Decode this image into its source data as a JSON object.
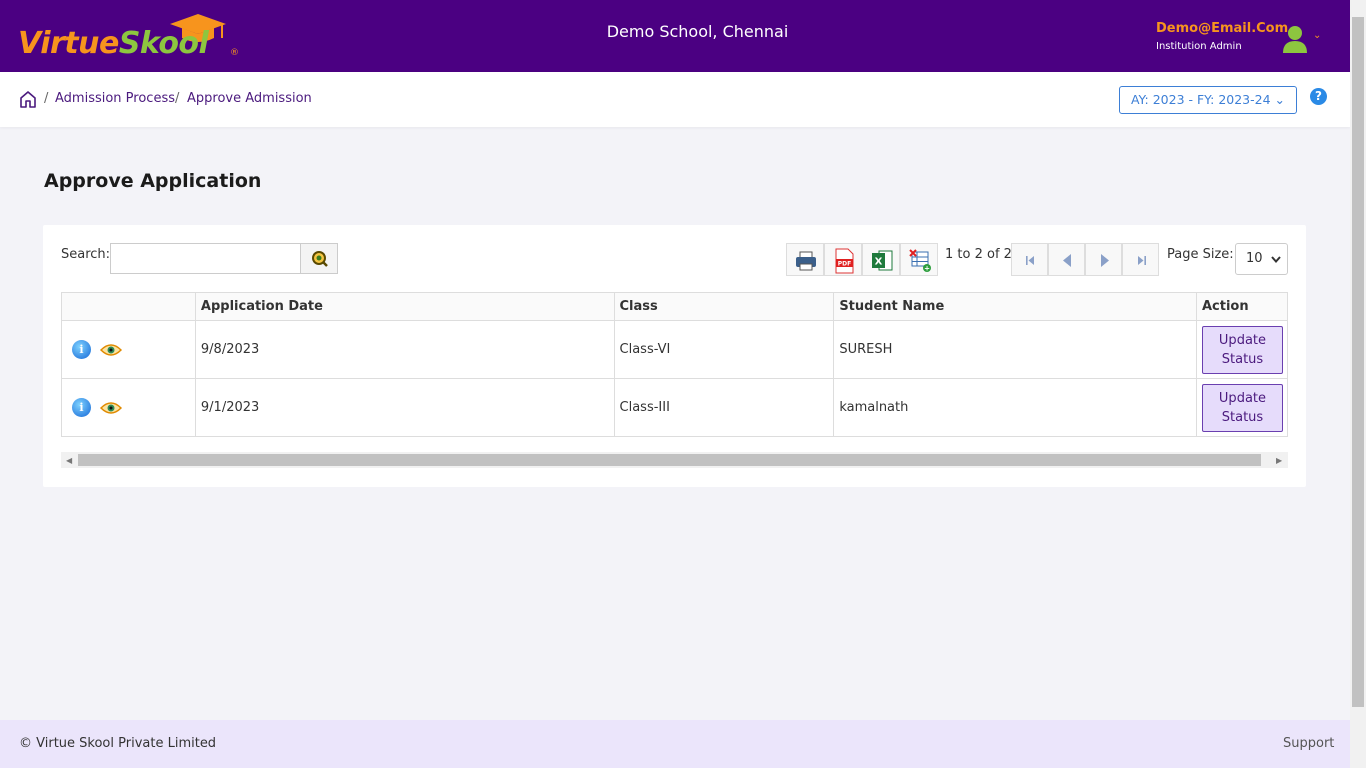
{
  "header": {
    "logo_part1": "Virtue",
    "logo_part2": "Skool",
    "logo_reg": "®",
    "school_name": "Demo School, Chennai",
    "user_email": "Demo@Email.Com",
    "user_role": "Institution Admin",
    "caret": "⌄"
  },
  "breadcrumb": {
    "items": [
      "Admission Process",
      "Approve Admission"
    ],
    "separator": "/"
  },
  "academic_year": "AY: 2023 - FY: 2023-24 ⌄",
  "help": "?",
  "page_title": "Approve Application",
  "toolbar": {
    "search_label": "Search:",
    "search_value": "",
    "pager_info": "1 to 2 of 2",
    "page_size_label": "Page Size:",
    "page_size_value": "10"
  },
  "table": {
    "columns": [
      "",
      "Application Date",
      "Class",
      "Student Name",
      "Action"
    ],
    "rows": [
      {
        "date": "9/8/2023",
        "class": "Class-VI",
        "student": "SURESH",
        "action": "Update Status"
      },
      {
        "date": "9/1/2023",
        "class": "Class-III",
        "student": "kamalnath",
        "action": "Update Status"
      }
    ]
  },
  "footer": {
    "copyright": "© Virtue Skool Private Limited",
    "support": "Support"
  },
  "colors": {
    "header_bg": "#4b0082",
    "accent_orange": "#f7941d",
    "accent_green": "#8dc63f",
    "footer_bg": "#ebe5fb"
  }
}
